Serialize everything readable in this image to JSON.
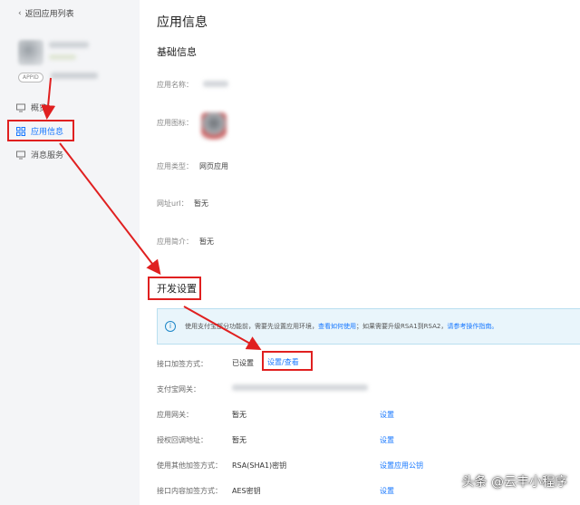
{
  "sidebar": {
    "back_label": "返回应用列表",
    "appid_badge": "APPID",
    "items": [
      {
        "label": "概览"
      },
      {
        "label": "应用信息"
      },
      {
        "label": "消息服务"
      }
    ]
  },
  "main": {
    "title": "应用信息",
    "basic_section": "基础信息",
    "fields": {
      "app_name_label": "应用名称：",
      "app_icon_label": "应用图标：",
      "app_type_label": "应用类型：",
      "app_type_value": "网页应用",
      "url_label": "网址url：",
      "url_value": "暂无",
      "intro_label": "应用简介：",
      "intro_value": "暂无"
    },
    "dev_section": "开发设置",
    "notice": {
      "icon": "info-icon",
      "text_a": "使用支付宝",
      "text_b": "部分功能前，需要先设置应用环境，",
      "link1": "查看如何使用",
      "text_c": "；如果需要升级RSA1到RSA2，",
      "link2": "请参考操作指南。"
    },
    "rows": [
      {
        "label": "接口加签方式：",
        "value": "已设置",
        "link": "设置/查看"
      },
      {
        "label": "支付宝网关：",
        "value": "",
        "link": ""
      },
      {
        "label": "应用网关：",
        "value": "暂无",
        "link": "设置"
      },
      {
        "label": "授权回调地址：",
        "value": "暂无",
        "link": "设置"
      },
      {
        "label": "使用其他加签方式：",
        "value": "RSA(SHA1)密钥",
        "link": "设置应用公钥"
      },
      {
        "label": "接口内容加签方式：",
        "value": "AES密钥",
        "link": "设置"
      }
    ]
  },
  "watermark": "头条 @云丰小程序",
  "colors": {
    "accent": "#1677ff",
    "annotation": "#e02020",
    "sidebar_bg": "#f4f5f7",
    "notice_bg": "#e9f5fb"
  }
}
